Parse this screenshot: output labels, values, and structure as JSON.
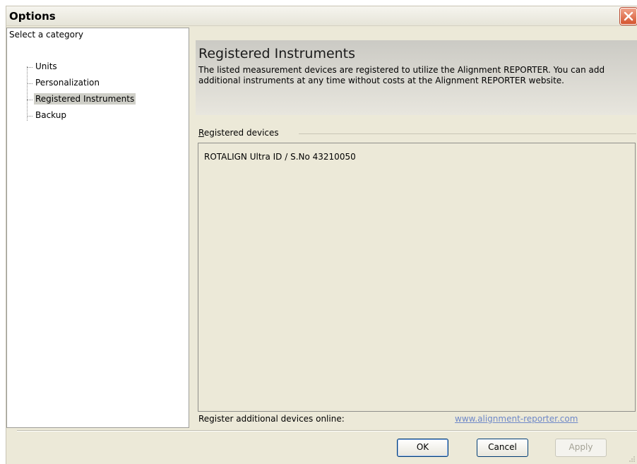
{
  "window": {
    "title": "Options"
  },
  "sidebar": {
    "label": "Select a category",
    "items": [
      {
        "label": "Units",
        "selected": false
      },
      {
        "label": "Personalization",
        "selected": false
      },
      {
        "label": "Registered Instruments",
        "selected": true
      },
      {
        "label": "Backup",
        "selected": false
      }
    ]
  },
  "panel": {
    "title": "Registered Instruments",
    "description": "The listed measurement devices are registered to utilize the Alignment REPORTER. You can add additional instruments at any time without costs at the Alignment REPORTER website.",
    "group_label_accel": "R",
    "group_label_rest": "egistered devices",
    "devices": [
      "ROTALIGN Ultra ID / S.No 43210050"
    ],
    "register_label": "Register additional devices online:",
    "register_link": "www.alignment-reporter.com"
  },
  "buttons": {
    "ok": "OK",
    "cancel": "Cancel",
    "apply": "Apply"
  },
  "colors": {
    "link": "#6e88c8",
    "close_button": "#d5542e",
    "selection": "#cfcfc8"
  }
}
